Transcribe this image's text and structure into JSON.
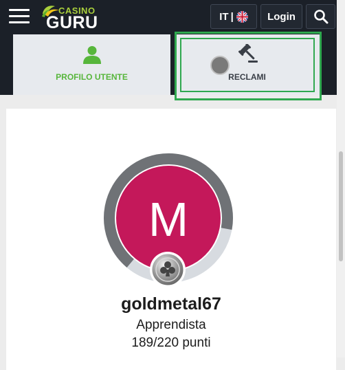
{
  "header": {
    "logo_top": "CASINO",
    "logo_bottom": "GURU",
    "language_code": "IT",
    "language_separator": "|",
    "login_label": "Login",
    "menu_icon": "hamburger-icon",
    "search_icon": "search-icon",
    "flag_icon": "uk-flag-icon"
  },
  "tabs": [
    {
      "label": "PROFILO UTENTE",
      "icon": "user-icon",
      "active": true
    },
    {
      "label": "RECLAMI",
      "icon": "gavel-icon",
      "active": false
    }
  ],
  "profile": {
    "avatar_letter": "M",
    "avatar_color": "#c4185a",
    "username": "goldmetal67",
    "rank": "Apprendista",
    "points": "189/220 punti",
    "progress_fraction": 0.859
  },
  "colors": {
    "accent_green": "#57b63b",
    "header_bg": "#1b2028",
    "highlight": "#2fa84f"
  }
}
